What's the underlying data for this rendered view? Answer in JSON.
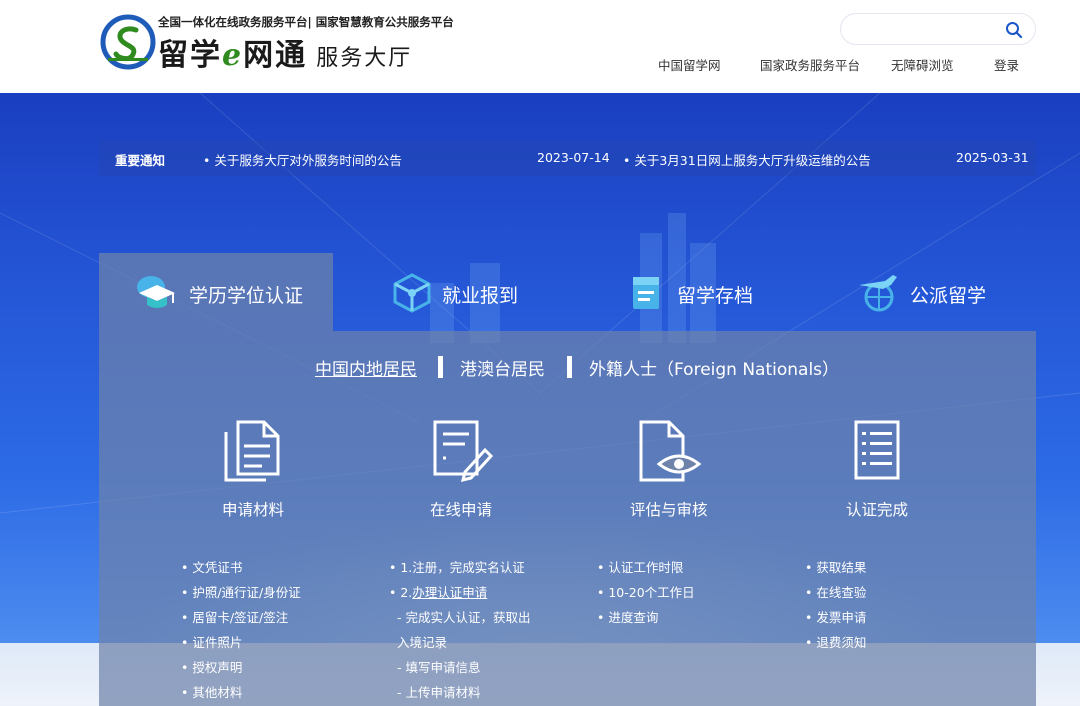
{
  "header": {
    "tagline": "全国一体化在线政务服务平台| 国家智慧教育公共服务平台",
    "brand_part1": "留学",
    "brand_e": "e",
    "brand_part2": "网通",
    "brand_sub": "服务大厅",
    "search_placeholder": "",
    "nav": [
      "中国留学网",
      "国家政务服务平台",
      "无障碍浏览",
      "登录"
    ]
  },
  "notice": {
    "label": "重要通知",
    "items": [
      {
        "text": "• 关于服务大厅对外服务时间的公告",
        "date": "2023-07-14"
      },
      {
        "text": "• 关于3月31日网上服务大厅升级运维的公告",
        "date": "2025-03-31"
      }
    ]
  },
  "tabs": [
    {
      "label": "学历学位认证",
      "icon": "graduation-cap-icon",
      "active": true
    },
    {
      "label": "就业报到",
      "icon": "cube-network-icon",
      "active": false
    },
    {
      "label": "留学存档",
      "icon": "archive-file-icon",
      "active": false
    },
    {
      "label": "公派留学",
      "icon": "airplane-globe-icon",
      "active": false
    }
  ],
  "subtabs": [
    "中国内地居民",
    "港澳台居民",
    "外籍人士（Foreign Nationals）"
  ],
  "steps": [
    {
      "label": "申请材料",
      "icon": "documents-icon"
    },
    {
      "label": "在线申请",
      "icon": "form-edit-icon"
    },
    {
      "label": "评估与审核",
      "icon": "file-eye-icon"
    },
    {
      "label": "认证完成",
      "icon": "checklist-icon"
    }
  ],
  "lists": {
    "materials": [
      "• 文凭证书",
      "• 护照/通行证/身份证",
      "• 居留卡/签证/签注",
      "• 证件照片",
      "• 授权声明",
      "• 其他材料"
    ],
    "apply": {
      "line1": "• 1.注册，完成实名认证",
      "line2_prefix": "• 2.",
      "line2_link": "办理认证申请",
      "sub1a": "- 完成实人认证，获取出",
      "sub1b": "入境记录",
      "sub2": "- 填写申请信息",
      "sub3": "- 上传申请材料"
    },
    "review": [
      "认证工作时限",
      "• 10-20个工作日",
      "进度查询"
    ],
    "done": [
      "获取结果",
      "在线查验",
      "发票申请",
      "退费须知"
    ]
  },
  "colors": {
    "accent_blue": "#1a56c8",
    "brand_green": "#2f8b1e",
    "banner_blue": "#2456d6"
  }
}
